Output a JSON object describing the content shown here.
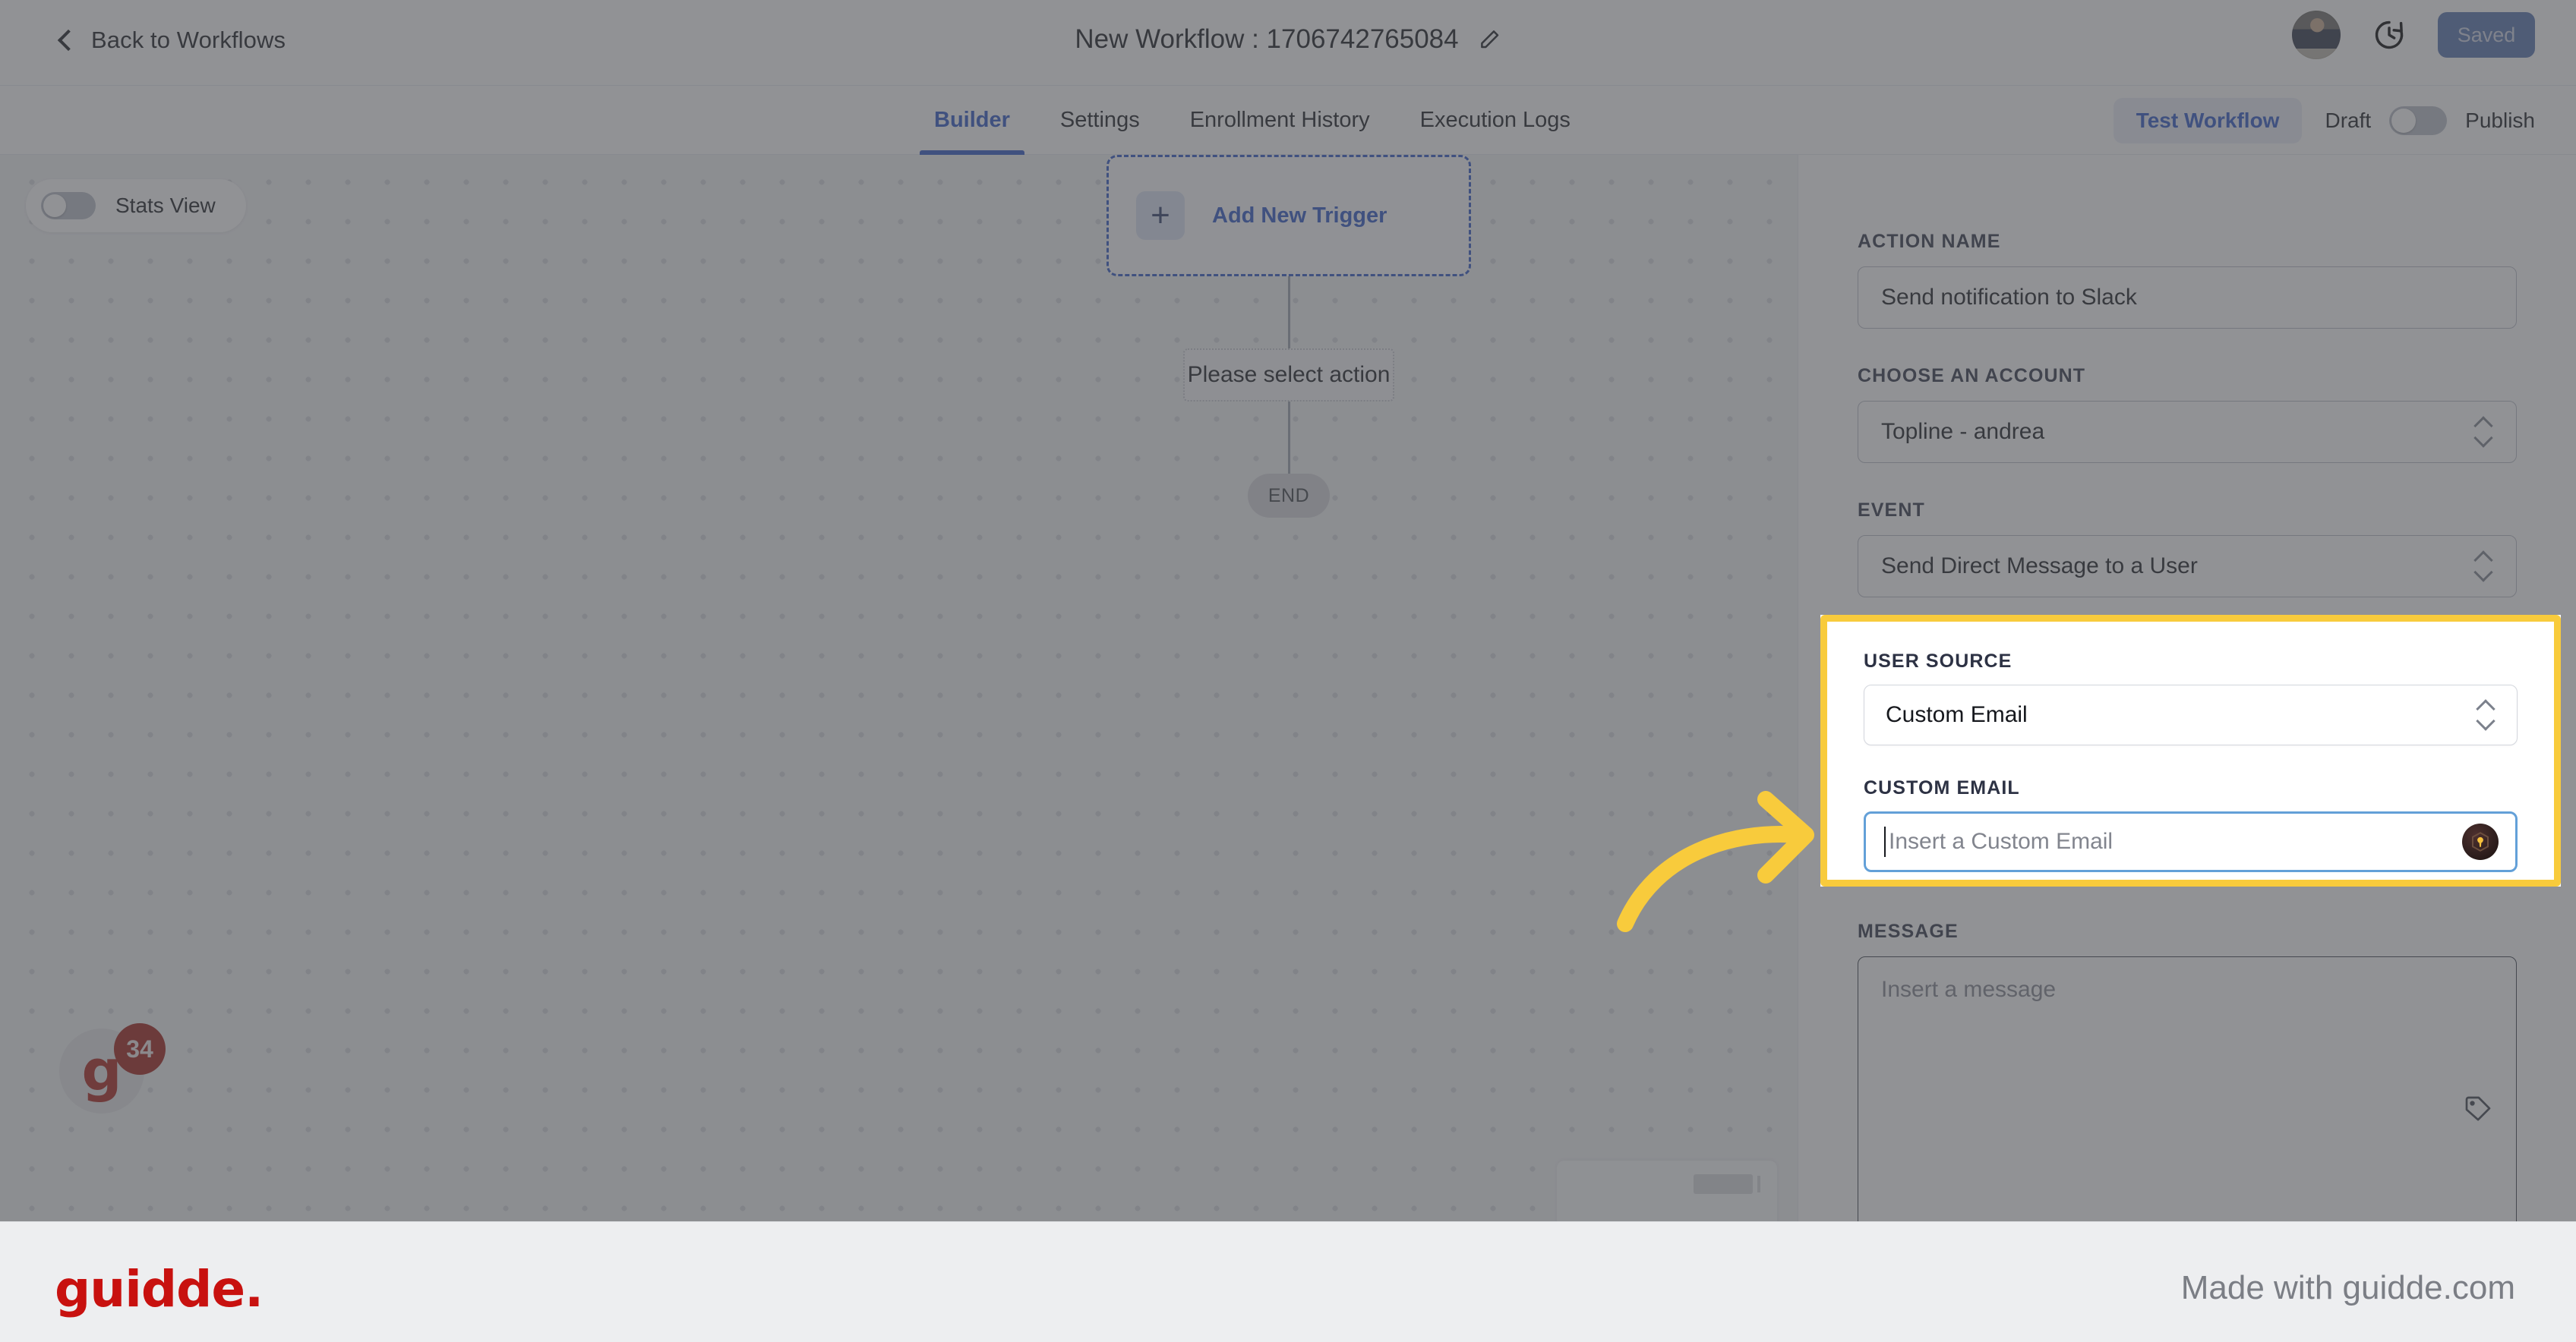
{
  "topbar": {
    "back_label": "Back to Workflows",
    "back_icon": "chevron-left-icon",
    "workflow_title": "New Workflow : 1706742765084",
    "edit_icon": "pencil-icon",
    "avatar": "user-avatar",
    "history_icon": "clock-history-icon",
    "saved_label": "Saved"
  },
  "tabs": [
    {
      "label": "Builder",
      "active": true
    },
    {
      "label": "Settings",
      "active": false
    },
    {
      "label": "Enrollment History",
      "active": false
    },
    {
      "label": "Execution Logs",
      "active": false
    }
  ],
  "tabbar_actions": {
    "test_workflow_label": "Test Workflow",
    "draft_label": "Draft",
    "publish_label": "Publish",
    "publish_toggle_state": "off"
  },
  "canvas": {
    "stats_view_label": "Stats View",
    "stats_view_state": "off",
    "add_trigger_label": "Add New Trigger",
    "plus_icon": "plus-icon",
    "action_placeholder_label": "Please select action",
    "end_label": "END",
    "chat_badge_count": "34"
  },
  "panel": {
    "action_name": {
      "label": "ACTION NAME",
      "value": "Send notification to Slack"
    },
    "account": {
      "label": "CHOOSE AN ACCOUNT",
      "value": "Topline - andrea"
    },
    "event": {
      "label": "EVENT",
      "value": "Send Direct Message to a User"
    },
    "user_source": {
      "label": "USER SOURCE",
      "value": "Custom Email"
    },
    "custom_email": {
      "label": "CUSTOM EMAIL",
      "placeholder": "Insert a Custom Email",
      "value": "",
      "trailing_icon": "key-badge-icon"
    },
    "message": {
      "label": "MESSAGE",
      "placeholder": "Insert a message",
      "value": "",
      "trailing_icon": "tag-icon"
    }
  },
  "annotation": {
    "arrow_icon": "curved-arrow-right-icon",
    "highlight_color": "#f8cb3c"
  },
  "footer": {
    "logo_text": "guidde.",
    "made_with": "Made with guidde.com"
  }
}
